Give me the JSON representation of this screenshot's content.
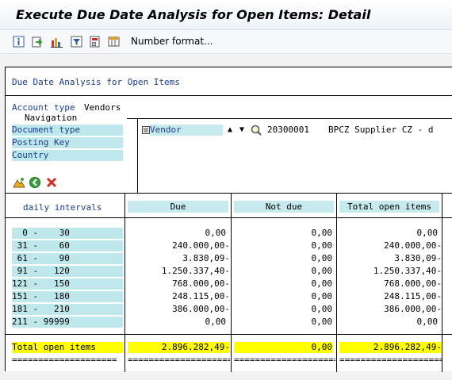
{
  "window": {
    "title": "Execute Due Date Analysis for Open Items: Detail"
  },
  "toolbar": {
    "icons": [
      "info-icon",
      "export-icon",
      "chart-icon",
      "filter-icon",
      "calculator-icon",
      "layout-icon"
    ],
    "number_format_label": "Number format..."
  },
  "report": {
    "heading": "Due Date Analysis for Open Items",
    "account_type_label": "Account type",
    "account_type_value": "Vendors",
    "navigation_label": "Navigation",
    "navigation_items": [
      "Document type",
      "Posting Key",
      "Country"
    ],
    "drill_field": "Vendor",
    "vendor_number": "20300001",
    "vendor_name": "BPCZ Supplier CZ - d",
    "columns": {
      "intervals": "daily intervals",
      "due": "Due",
      "not_due": "Not due",
      "total": "Total open items"
    },
    "rows": [
      {
        "interval": "  0 -    30",
        "due": "0,00",
        "not_due": "0,00",
        "total": "0,00"
      },
      {
        "interval": " 31 -    60",
        "due": "240.000,00-",
        "not_due": "0,00",
        "total": "240.000,00-"
      },
      {
        "interval": " 61 -    90",
        "due": "3.830,09-",
        "not_due": "0,00",
        "total": "3.830,09-"
      },
      {
        "interval": " 91 -   120",
        "due": "1.250.337,40-",
        "not_due": "0,00",
        "total": "1.250.337,40-"
      },
      {
        "interval": "121 -   150",
        "due": "768.000,00-",
        "not_due": "0,00",
        "total": "768.000,00-"
      },
      {
        "interval": "151 -   180",
        "due": "248.115,00-",
        "not_due": "0,00",
        "total": "248.115,00-"
      },
      {
        "interval": "181 -   210",
        "due": "386.000,00-",
        "not_due": "0,00",
        "total": "386.000,00-"
      },
      {
        "interval": "211 - 99999",
        "due": "0,00",
        "not_due": "0,00",
        "total": "0,00"
      }
    ],
    "totals": {
      "label": "Total open items",
      "due": "2.896.282,49-",
      "not_due": "0,00",
      "total": "2.896.282,49-"
    },
    "separator": "===================="
  },
  "colors": {
    "teal": "#bfe8ec",
    "yellow": "#ffff00",
    "blue_text": "#1a3c8c"
  }
}
